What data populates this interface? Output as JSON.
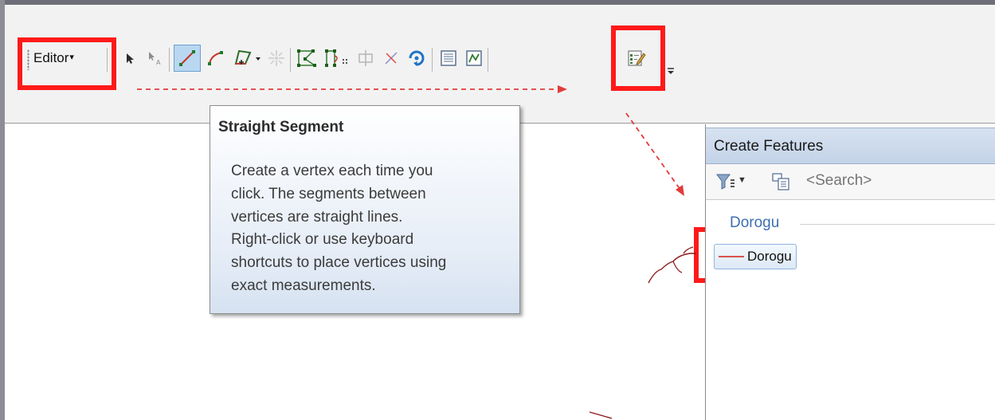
{
  "toolbar": {
    "editor_menu_label": "Editor",
    "tools": [
      "edit-tool",
      "edit-annotation-tool",
      "straight-segment-tool",
      "end-point-arc-tool",
      "trace-tool",
      "point-tool",
      "edit-vertices-tool",
      "reshape-feature-tool",
      "cut-polygons-tool",
      "split-tool",
      "rotate-tool",
      "attributes-tool",
      "sketch-properties-tool",
      "create-features-window-tool"
    ]
  },
  "tooltip": {
    "title": "Straight Segment",
    "lines": [
      "Create a vertex each time you",
      "click. The segments between",
      "vertices are straight lines.",
      "Right-click or use keyboard",
      "shortcuts to place vertices using",
      "exact measurements."
    ]
  },
  "create_features": {
    "title": "Create Features",
    "search_placeholder": "<Search>",
    "group_label": "Dorogu",
    "template_label": "Dorogu",
    "template_color": "#d9534f"
  },
  "colors": {
    "highlight": "#ff1a1a",
    "active_tool": "#b9d7f1",
    "header": "#c3d3e8"
  }
}
